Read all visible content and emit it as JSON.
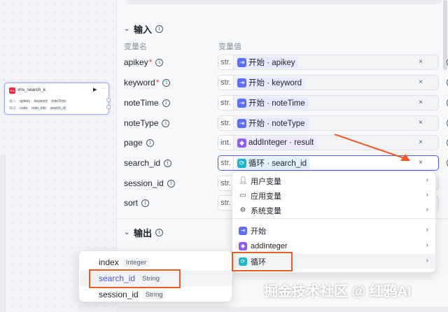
{
  "node": {
    "logo": "xhs",
    "title": "xhs_search_k",
    "run_icon": "play-icon",
    "more_icon": "more-icon",
    "input_tag": "输入",
    "output_tag": "输出",
    "inputs": [
      "apikey",
      "keyword",
      "noteTime"
    ],
    "outputs": [
      "code",
      "note_info",
      "search_id"
    ]
  },
  "panel": {
    "input_section": "输入",
    "col_name": "变量名",
    "col_value": "变量值",
    "output_section": "输出",
    "rows": [
      {
        "name": "apikey",
        "required": "*",
        "type": "str.",
        "ref": "开始 · apikey",
        "icon": "start"
      },
      {
        "name": "keyword",
        "required": "*",
        "type": "str.",
        "ref": "开始 · keyword",
        "icon": "start"
      },
      {
        "name": "noteTime",
        "required": "",
        "type": "str.",
        "ref": "开始 · noteTime",
        "icon": "start"
      },
      {
        "name": "noteType",
        "required": "",
        "type": "str.",
        "ref": "开始 · noteType",
        "icon": "start"
      },
      {
        "name": "page",
        "required": "",
        "type": "int.",
        "ref": "addInteger · result",
        "icon": "cube"
      },
      {
        "name": "search_id",
        "required": "",
        "type": "str.",
        "ref": "循环 · search_id",
        "icon": "loop"
      },
      {
        "name": "session_id",
        "required": "",
        "type": "str.",
        "ref": "",
        "icon": ""
      },
      {
        "name": "sort",
        "required": "",
        "type": "str.",
        "ref": "",
        "icon": ""
      }
    ],
    "clear_glyph": "×"
  },
  "dropdown": {
    "groups": [
      "用户变量",
      "应用变量",
      "系统变量"
    ],
    "nodes": [
      "开始",
      "addInteger",
      "循环"
    ]
  },
  "subpop": {
    "items": [
      {
        "name": "index",
        "type": "Integer"
      },
      {
        "name": "search_id",
        "type": "String"
      },
      {
        "name": "session_id",
        "type": "String"
      }
    ]
  },
  "colors": {
    "accent": "#4d53e8",
    "annotation": "#ee5a24",
    "start": "#5b6cf6",
    "loop": "#1fb6c9",
    "cube": "#8e5cf7"
  },
  "watermark": "掘金技术社区 @ 红鸦AI"
}
